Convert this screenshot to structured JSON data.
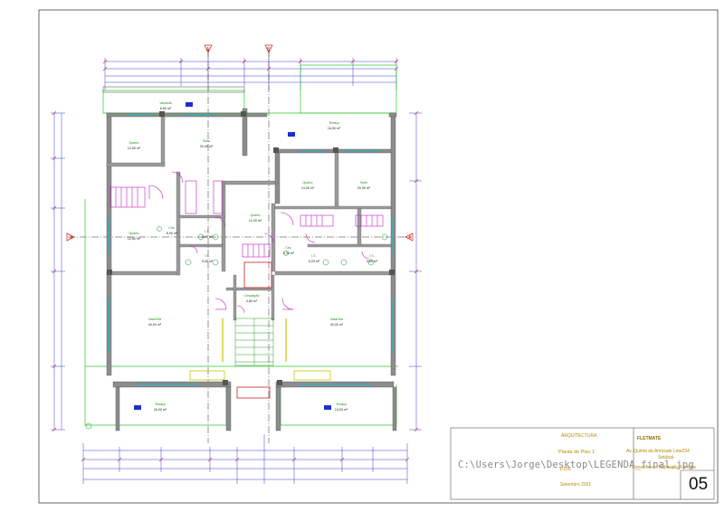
{
  "title_block": {
    "discipline": "ARQUITECTURA",
    "drawing_title": "Planta do Piso 1",
    "scale": "1/100",
    "date": "Setembro 2021",
    "company": "FLETMATE",
    "address_line1": "Av. Quinta da Amizade Lote234",
    "address_line2": "Setúbal",
    "address_line3": "Conselho de Habitação Familiar",
    "sheet_number": "05"
  },
  "file_path_overlay": "C:\\Users\\Jorge\\Desktop\\LEGENDA_final.jpg",
  "section_markers": {
    "top_left": "A'",
    "top_right": "B'",
    "side_left": "A",
    "side_right": "A"
  },
  "rooms": [
    {
      "name": "Varanda",
      "area": "8,80 m²"
    },
    {
      "name": "Quarto",
      "area": "12,50 m²"
    },
    {
      "name": "Suite",
      "area": "20,00 m²"
    },
    {
      "name": "Terraço",
      "area": "16,00 m²"
    },
    {
      "name": "Quarto",
      "area": "14,00 m²"
    },
    {
      "name": "Suite",
      "area": "20,00 m²"
    },
    {
      "name": "Quarto",
      "area": "12,50 m²"
    },
    {
      "name": "Circ.",
      "area": "6,00 m²"
    },
    {
      "name": "I.S.",
      "area": "3,60 m²"
    },
    {
      "name": "Quarto",
      "area": "12,00 m²"
    },
    {
      "name": "I.S.",
      "area": "5,00 m²"
    },
    {
      "name": "Circ.",
      "area": "2,30 m²"
    },
    {
      "name": "I.S.",
      "area": "5,20 m²"
    },
    {
      "name": "I.S.",
      "area": "3,60 m²"
    },
    {
      "name": "Circulação",
      "area": "3,80 m²"
    },
    {
      "name": "Sala/Vila",
      "area": "43,00 m²"
    },
    {
      "name": "Sala/Vila",
      "area": "40,00 m²"
    },
    {
      "name": "Terraço",
      "area": "26,00 m²"
    },
    {
      "name": "Terraço",
      "area": "13,00 m²"
    }
  ]
}
